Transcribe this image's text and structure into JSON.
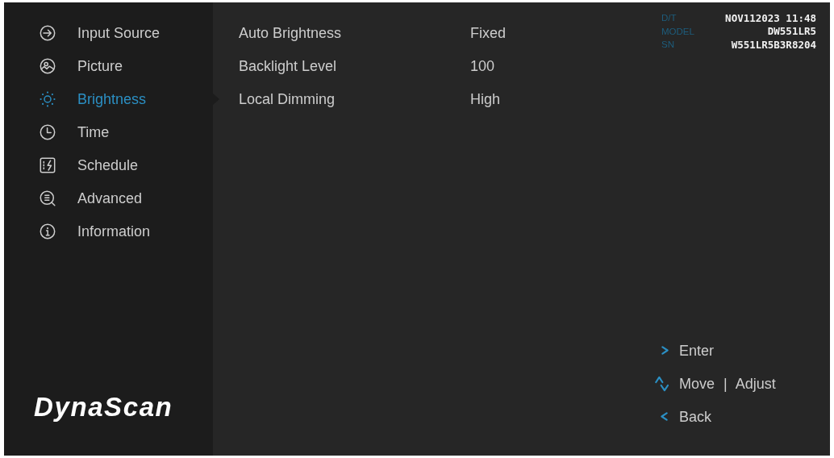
{
  "sidebar": {
    "items": [
      {
        "label": "Input Source",
        "selected": false
      },
      {
        "label": "Picture",
        "selected": false
      },
      {
        "label": "Brightness",
        "selected": true
      },
      {
        "label": "Time",
        "selected": false
      },
      {
        "label": "Schedule",
        "selected": false
      },
      {
        "label": "Advanced",
        "selected": false
      },
      {
        "label": "Information",
        "selected": false
      }
    ],
    "logo": "DynaScan"
  },
  "settings": {
    "rows": [
      {
        "label": "Auto Brightness",
        "value": "Fixed"
      },
      {
        "label": "Backlight Level",
        "value": "100"
      },
      {
        "label": "Local Dimming",
        "value": "High"
      }
    ]
  },
  "device_info": [
    {
      "label": "D/T",
      "value": "NOV112023 11:48"
    },
    {
      "label": "MODEL",
      "value": "DW551LR5"
    },
    {
      "label": "SN",
      "value": "W551LR5B3R8204"
    }
  ],
  "key_hints": [
    {
      "kind": "enter",
      "label": "Enter"
    },
    {
      "kind": "move",
      "label": "Move | Adjust"
    },
    {
      "kind": "back",
      "label": "Back"
    }
  ]
}
